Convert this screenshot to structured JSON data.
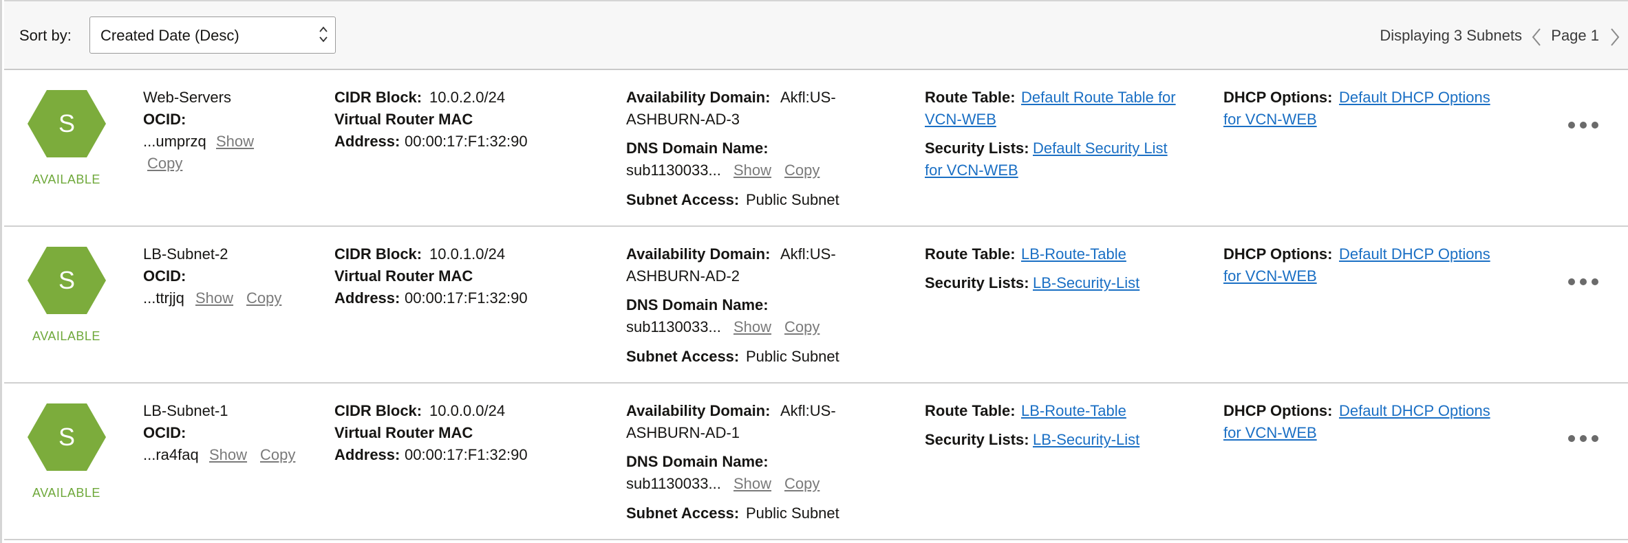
{
  "toolbar": {
    "sort_label": "Sort by:",
    "sort_value": "Created Date (Desc)",
    "displaying": "Displaying 3 Subnets",
    "page": "Page 1"
  },
  "labels": {
    "ocid": "OCID:",
    "show": "Show",
    "copy": "Copy",
    "cidr_block": "CIDR Block:",
    "vr_mac_1": "Virtual Router MAC",
    "vr_mac_2": "Address:",
    "availability_domain": "Availability Domain:",
    "dns_domain_name": "DNS Domain Name:",
    "subnet_access": "Subnet Access:",
    "route_table": "Route Table:",
    "security_lists": "Security Lists:",
    "dhcp_options": "DHCP Options:"
  },
  "colors": {
    "hex_fill": "#7cac3c",
    "state_text": "#6ea83a",
    "link": "#1a6fc4"
  },
  "subnets": [
    {
      "icon_letter": "S",
      "state": "AVAILABLE",
      "name": "Web-Servers",
      "ocid": "...umprzq",
      "cidr": "10.0.2.0/24",
      "mac": "00:00:17:F1:32:90",
      "ad_line1": "Akfl:US-",
      "ad_line2": "ASHBURN-AD-3",
      "dns": "sub1130033...",
      "access": "Public Subnet",
      "route_table_1": "Default Route Table for",
      "route_table_2": "VCN-WEB",
      "security_lists_1": "Default Security List",
      "security_lists_2": "for VCN-WEB",
      "dhcp_1": "Default DHCP Options",
      "dhcp_2": "for VCN-WEB"
    },
    {
      "icon_letter": "S",
      "state": "AVAILABLE",
      "name": "LB-Subnet-2",
      "ocid": "...ttrjjq",
      "cidr": "10.0.1.0/24",
      "mac": "00:00:17:F1:32:90",
      "ad_line1": "Akfl:US-",
      "ad_line2": "ASHBURN-AD-2",
      "dns": "sub1130033...",
      "access": "Public Subnet",
      "route_table_1": "LB-Route-Table",
      "security_lists_1": "LB-Security-List",
      "dhcp_1": "Default DHCP Options",
      "dhcp_2": "for VCN-WEB"
    },
    {
      "icon_letter": "S",
      "state": "AVAILABLE",
      "name": "LB-Subnet-1",
      "ocid": "...ra4faq",
      "cidr": "10.0.0.0/24",
      "mac": "00:00:17:F1:32:90",
      "ad_line1": "Akfl:US-",
      "ad_line2": "ASHBURN-AD-1",
      "dns": "sub1130033...",
      "access": "Public Subnet",
      "route_table_1": "LB-Route-Table",
      "security_lists_1": "LB-Security-List",
      "dhcp_1": "Default DHCP Options",
      "dhcp_2": "for VCN-WEB"
    }
  ]
}
